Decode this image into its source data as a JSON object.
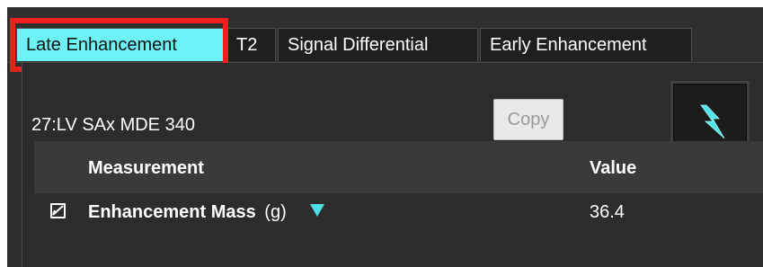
{
  "tabs": [
    {
      "label": "Late Enhancement",
      "active": true
    },
    {
      "label": "T2",
      "active": false
    },
    {
      "label": "Signal Differential",
      "active": false
    },
    {
      "label": "Early Enhancement",
      "active": false
    }
  ],
  "toolbar": {
    "series_label": "27:LV SAx MDE  340",
    "copy_label": "Copy",
    "lightning_icon": "lightning-icon"
  },
  "table": {
    "headers": {
      "measurement": "Measurement",
      "value": "Value"
    },
    "rows": [
      {
        "checked": true,
        "measurement": "Enhancement Mass",
        "unit": "(g)",
        "value": "36.4"
      }
    ]
  },
  "colors": {
    "active_tab": "#6df3f6",
    "highlight": "#ef1f1f",
    "accent": "#4cdfe4",
    "panel": "#2c2c2c"
  }
}
